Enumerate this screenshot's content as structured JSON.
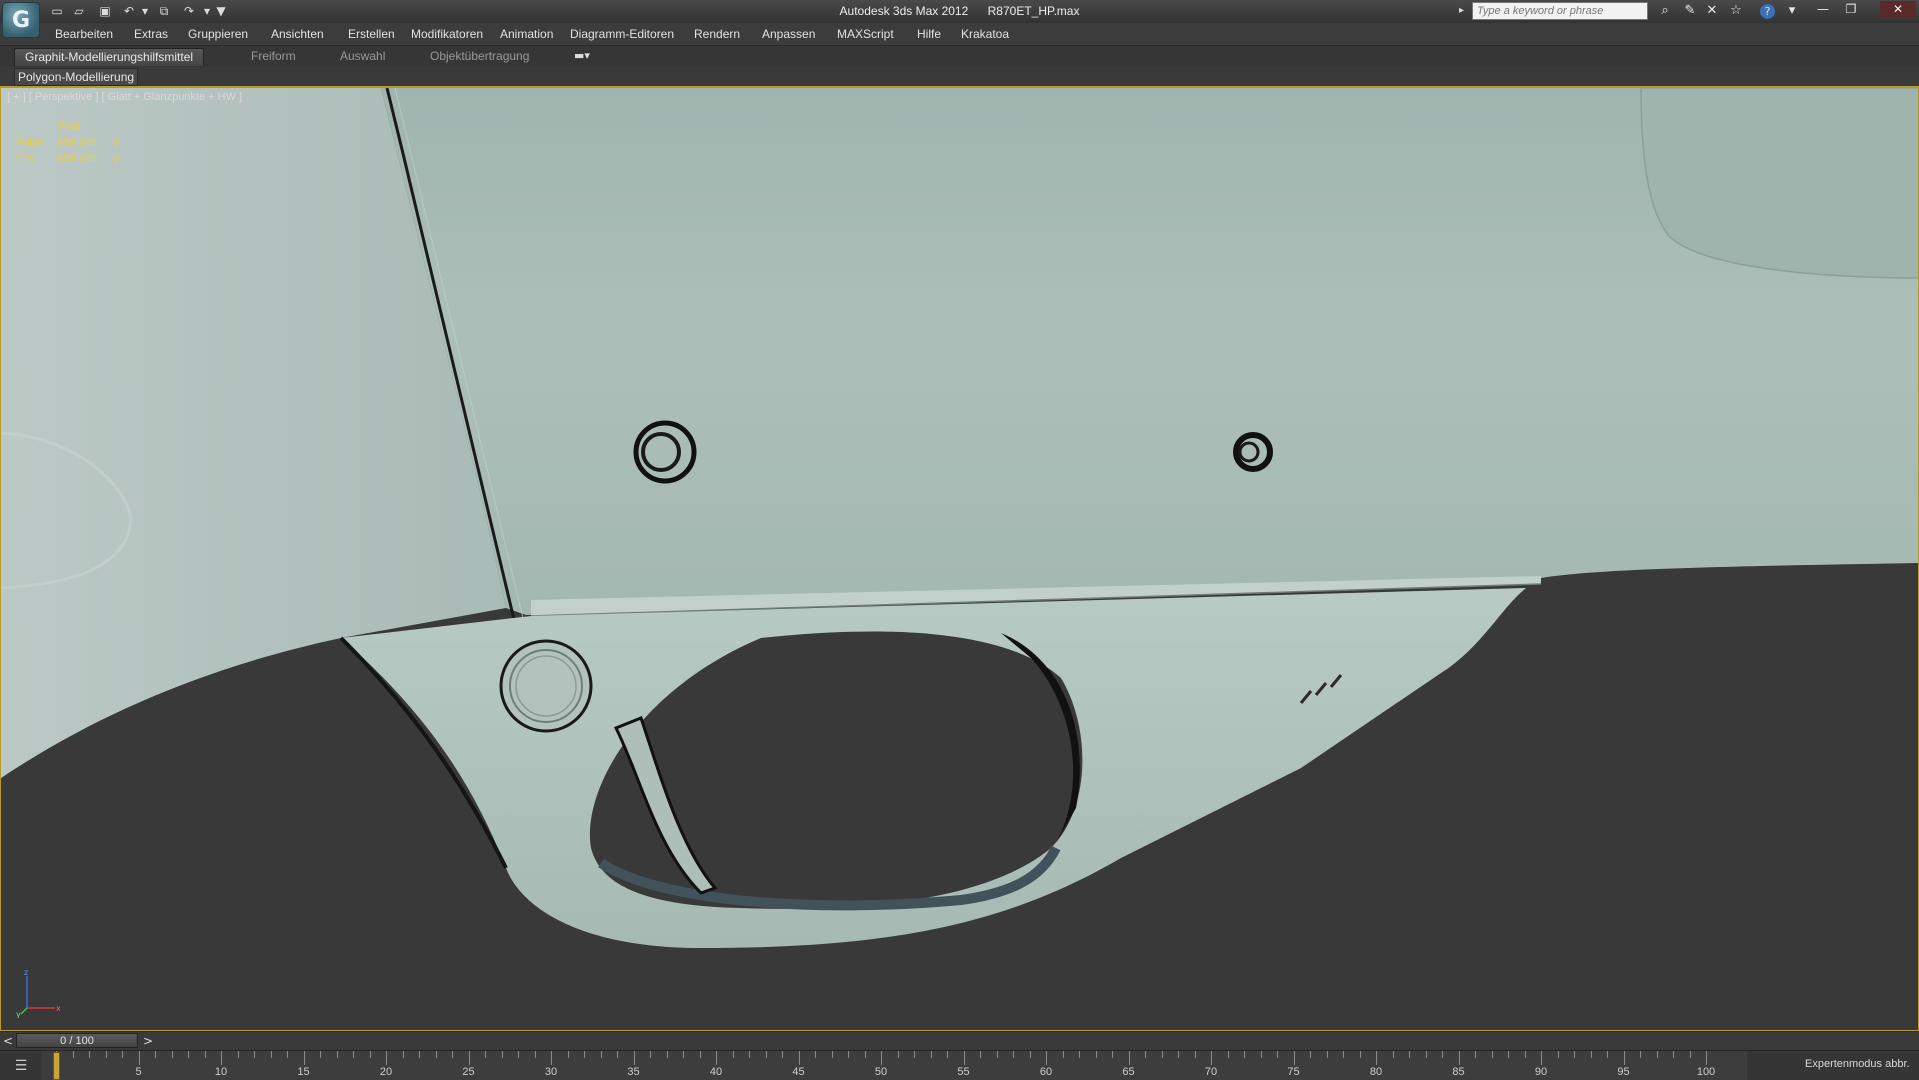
{
  "titlebar": {
    "app_name": "Autodesk 3ds Max  2012",
    "file_name": "R870ET_HP.max",
    "logo_glyph": "G",
    "quick_access": [
      {
        "name": "new-file-icon",
        "glyph": "▭"
      },
      {
        "name": "open-folder-icon",
        "glyph": "▱"
      },
      {
        "name": "save-icon",
        "glyph": "▣"
      },
      {
        "name": "undo-icon",
        "glyph": "↶"
      },
      {
        "name": "undo-dropdown-icon",
        "glyph": "▾"
      },
      {
        "name": "hold-icon",
        "glyph": "⧉"
      },
      {
        "name": "redo-icon",
        "glyph": "↷"
      },
      {
        "name": "redo-dropdown-icon",
        "glyph": "▾"
      },
      {
        "name": "customize-toolbar-icon",
        "glyph": "▼"
      }
    ],
    "search_placeholder": "Type a keyword or phrase",
    "info_icons": [
      {
        "name": "binoculars-icon",
        "glyph": "⌕"
      },
      {
        "name": "wrench-icon",
        "glyph": "✎"
      },
      {
        "name": "communication-center-icon",
        "glyph": "✕"
      },
      {
        "name": "favorites-star-icon",
        "glyph": "☆"
      },
      {
        "name": "help-icon",
        "glyph": "?"
      },
      {
        "name": "help-dropdown-icon",
        "glyph": "▾"
      }
    ],
    "window_buttons": {
      "minimize": "—",
      "maximize": "❐",
      "close": "✕"
    }
  },
  "menubar": {
    "items": [
      "Bearbeiten",
      "Extras",
      "Gruppieren",
      "Ansichten",
      "Erstellen",
      "Modifikatoren",
      "Animation",
      "Diagramm-Editoren",
      "Rendern",
      "Anpassen",
      "MAXScript",
      "Hilfe",
      "Krakatoa"
    ]
  },
  "ribbon": {
    "tabs": [
      "Graphit-Modellierungshilfsmittel",
      "Freiform",
      "Auswahl",
      "Objektübertragung"
    ],
    "active_tab": 0,
    "options_glyph": "▬▾",
    "panel_label": "Polygon-Modellierung"
  },
  "viewport": {
    "label": "[ + ] [ Perspektive ] [ Glatt + Glanzpunkte + HW ]",
    "stats": {
      "header": "Total",
      "rows": [
        {
          "label": "Polys:",
          "total": "850.428",
          "selected": "0"
        },
        {
          "label": "Tris:",
          "total": "850.428",
          "selected": "0"
        }
      ]
    },
    "axis_labels": {
      "x": "x",
      "y": "y",
      "z": "z"
    },
    "colors": {
      "background": "#393939",
      "model_fill": "#a9bcb6",
      "stats_text": "#e8d040",
      "active_border": "#b89a2a"
    }
  },
  "timeline": {
    "slider_label": "0 / 100",
    "prev_glyph": "<",
    "next_glyph": ">",
    "frame_start": 0,
    "frame_end": 100,
    "current_frame": 0,
    "tick_labels": [
      "5",
      "10",
      "15",
      "20",
      "25",
      "30",
      "35",
      "40",
      "45",
      "50",
      "55",
      "60",
      "65",
      "70",
      "75",
      "80",
      "85",
      "90",
      "95",
      "100"
    ],
    "track_icon_glyph": "☰",
    "expert_mode_label": "Expertenmodus abbr."
  }
}
